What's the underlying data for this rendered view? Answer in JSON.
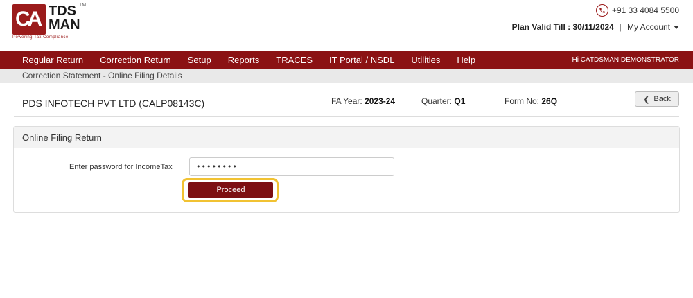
{
  "logo": {
    "mark": "CA",
    "name_line1": "TDS",
    "name_line2": "MAN",
    "trademark": "TM",
    "tagline": "Powering Tax Compliance"
  },
  "header": {
    "phone": "+91 33 4084 5500",
    "plan_label": "Plan Valid Till : 30/11/2024",
    "separator": "|",
    "account_label": "My Account"
  },
  "nav": {
    "items": [
      "Regular Return",
      "Correction Return",
      "Setup",
      "Reports",
      "TRACES",
      "IT Portal / NSDL",
      "Utilities",
      "Help"
    ],
    "greeting": "Hi CATDSMAN DEMONSTRATOR"
  },
  "breadcrumb": "Correction Statement - Online Filing Details",
  "info": {
    "company": "PDS INFOTECH PVT LTD (CALP08143C)",
    "fa_label": "FA Year:",
    "fa_value": "2023-24",
    "quarter_label": "Quarter:",
    "quarter_value": "Q1",
    "form_label": "Form No:",
    "form_value": "26Q",
    "back_label": "Back"
  },
  "panel": {
    "title": "Online Filing Return",
    "password_label": "Enter password for IncomeTax",
    "password_value": "••••••••",
    "proceed_label": "Proceed"
  },
  "colors": {
    "brand": "#8b1214",
    "highlight": "#f1c232"
  }
}
